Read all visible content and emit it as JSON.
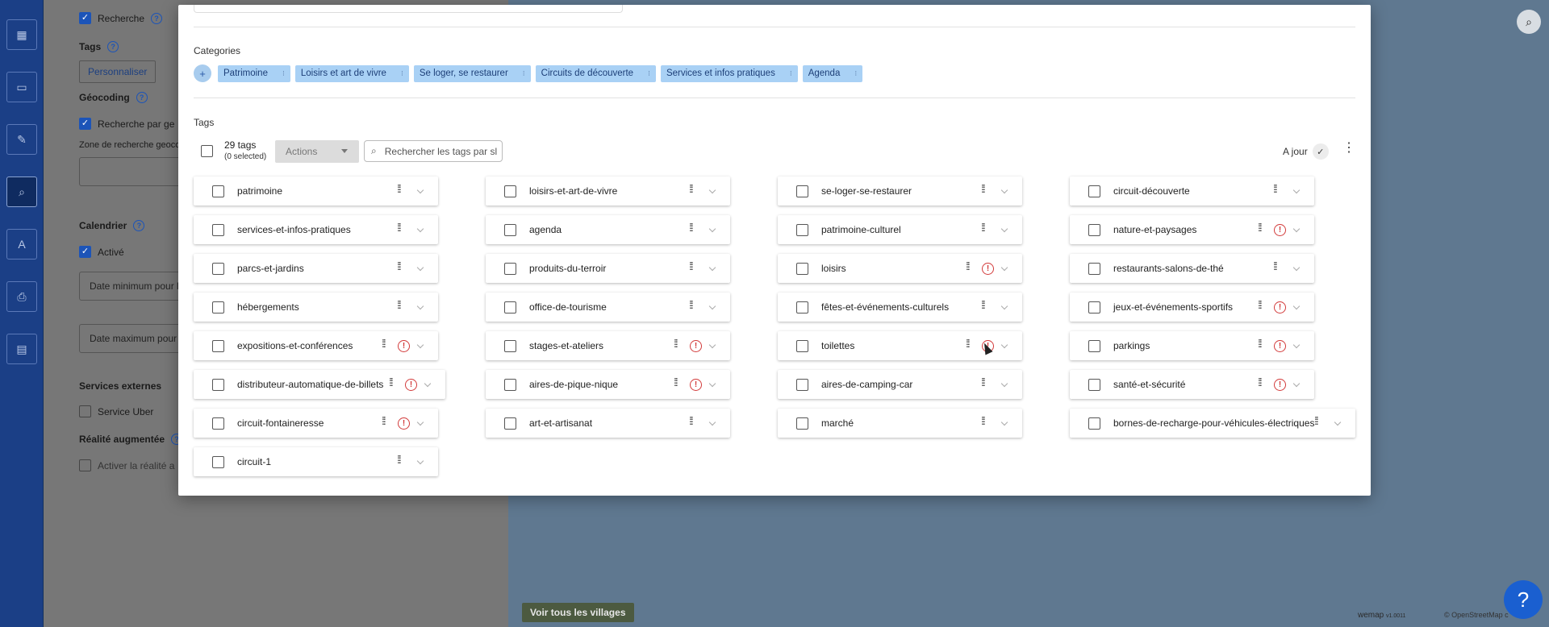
{
  "settings": {
    "search_label": "Recherche",
    "tags_header": "Tags",
    "customize_button": "Personnaliser",
    "geocoding_header": "Géocoding",
    "geocoding_search_label": "Recherche par ge",
    "geocoding_zone_label": "Zone de recherche geoco",
    "calendar_header": "Calendrier",
    "calendar_active_label": "Activé",
    "date_min_placeholder": "Date minimum pour l",
    "date_max_placeholder": "Date maximum pour",
    "external_services_header": "Services externes",
    "uber_label": "Service Uber",
    "ar_header": "Réalité augmentée",
    "ar_enable_label": "Activer la réalité a"
  },
  "map": {
    "villages_button": "Voir tous les villages",
    "wemap_brand": "wemap",
    "wemap_version": "v1.0011",
    "osm_credit": "© OpenStreetMap c",
    "help_label": "?"
  },
  "modal": {
    "categories_title": "Categories",
    "categories": [
      "Patrimoine",
      "Loisirs et art de vivre",
      "Se loger, se restaurer",
      "Circuits de découverte",
      "Services et infos pratiques",
      "Agenda"
    ],
    "tags_title": "Tags",
    "tags_count": "29 tags",
    "tags_selected": "(0 selected)",
    "actions_label": "Actions",
    "search_placeholder": "Rechercher les tags par sl",
    "status_label": "A jour",
    "tags": [
      "patrimoine",
      "loisirs-et-art-de-vivre",
      "se-loger-se-restaurer",
      "circuit-découverte",
      "services-et-infos-pratiques",
      "agenda",
      "patrimoine-culturel",
      "nature-et-paysages",
      "parcs-et-jardins",
      "produits-du-terroir",
      "loisirs",
      "restaurants-salons-de-thé",
      "hébergements",
      "office-de-tourisme",
      "fêtes-et-événements-culturels",
      "jeux-et-événements-sportifs",
      "expositions-et-conférences",
      "stages-et-ateliers",
      "toilettes",
      "parkings",
      "distributeur-automatique-de-billets",
      "aires-de-pique-nique",
      "aires-de-camping-car",
      "santé-et-sécurité",
      "circuit-fontaineresse",
      "art-et-artisanat",
      "marché",
      "bornes-de-recharge-pour-véhicules-électriques",
      "circuit-1"
    ],
    "warnings": [
      false,
      false,
      false,
      false,
      false,
      false,
      false,
      true,
      false,
      false,
      true,
      false,
      false,
      false,
      false,
      true,
      true,
      true,
      true,
      true,
      true,
      true,
      false,
      true,
      true,
      false,
      false,
      false,
      false
    ]
  }
}
